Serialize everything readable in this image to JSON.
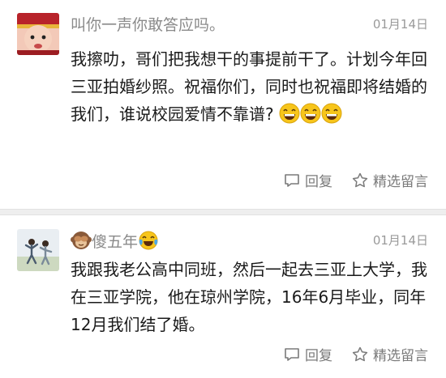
{
  "comments": [
    {
      "username": "叫你一声你敢答应吗。",
      "date": "01月14日",
      "text_a": "我擦叻，哥们把我想干的事提前干了。计划今年回三亚拍婚纱照。祝福你们，同时也祝福即将结婚的我们，谁说校园爱情不靠谱?",
      "reply_label": "回复",
      "featured_label": "精选留言"
    },
    {
      "username": "傻五年",
      "date": "01月14日",
      "text": "我跟我老公高中同班，然后一起去三亚上大学，我在三亚学院，他在琼州学院，16年6月毕业，同年12月我们结了婚。",
      "reply_label": "回复",
      "featured_label": "精选留言"
    }
  ],
  "icons": {
    "grin": "grinning-face-icon",
    "monkey": "see-no-evil-monkey-icon",
    "tears": "tears-of-joy-icon",
    "reply": "comment-bubble-icon",
    "featured": "star-outline-icon"
  },
  "colors": {
    "emoji_yellow": "#f7c51b",
    "meta_gray": "#8a8a8a"
  }
}
